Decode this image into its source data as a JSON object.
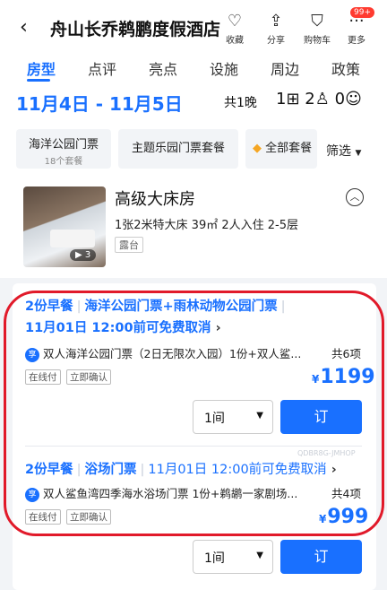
{
  "header": {
    "back_glyph": "‹",
    "title": "舟山长乔鹈鹏度假酒店",
    "actions": [
      {
        "label": "收藏",
        "icon": "heart-icon"
      },
      {
        "label": "分享",
        "icon": "share-icon"
      },
      {
        "label": "购物车",
        "icon": "cart-icon"
      },
      {
        "label": "更多",
        "icon": "more-icon",
        "badge": "99+"
      }
    ]
  },
  "tabs": [
    "房型",
    "点评",
    "亮点",
    "设施",
    "周边",
    "政策"
  ],
  "booking": {
    "dates": "11月4日 - 11月5日",
    "nights": "共1晚",
    "rooms": "1",
    "adults": "2",
    "children": "0"
  },
  "filters": {
    "chips": [
      {
        "label": "海洋公园门票",
        "sub": "18个套餐"
      },
      {
        "label": "主题乐园门票套餐",
        "sub": ""
      },
      {
        "label": "全部套餐",
        "sub": ""
      }
    ],
    "sort_label": "筛选"
  },
  "room": {
    "name": "高级大床房",
    "desc": "1张2米特大床 39㎡ 2人入住 2-5层",
    "tag": "露台",
    "media_count": "3"
  },
  "offers": [
    {
      "line1_a": "2份早餐",
      "line1_b": "海洋公园门票+雨林动物公园门票",
      "line2": "11月01日 12:00前可免费取消",
      "pkg_badge": "享",
      "pkg_text": "双人海洋公园门票（2日无限次入园）1份+双人鲨...",
      "pkg_count": "共6项",
      "tags": [
        "在线付",
        "立即确认"
      ],
      "currency": "¥",
      "price": "1199",
      "qty": "1间",
      "book_label": "订"
    },
    {
      "line1_a": "2份早餐",
      "line1_b": "浴场门票",
      "line2": "11月01日 12:00前可免费取消",
      "pkg_badge": "享",
      "pkg_text": "双人鲨鱼湾四季海水浴场门票 1份+鹈鹕一家剧场...",
      "pkg_count": "共4项",
      "tags": [
        "在线付",
        "立即确认"
      ],
      "currency": "¥",
      "price": "999",
      "qty": "1间",
      "book_label": "订"
    }
  ],
  "watermark": "QDBR8G-JMHOP",
  "colors": {
    "accent": "#1970ff",
    "highlight_ring": "#e11a2a",
    "badge": "#ff3b30"
  }
}
